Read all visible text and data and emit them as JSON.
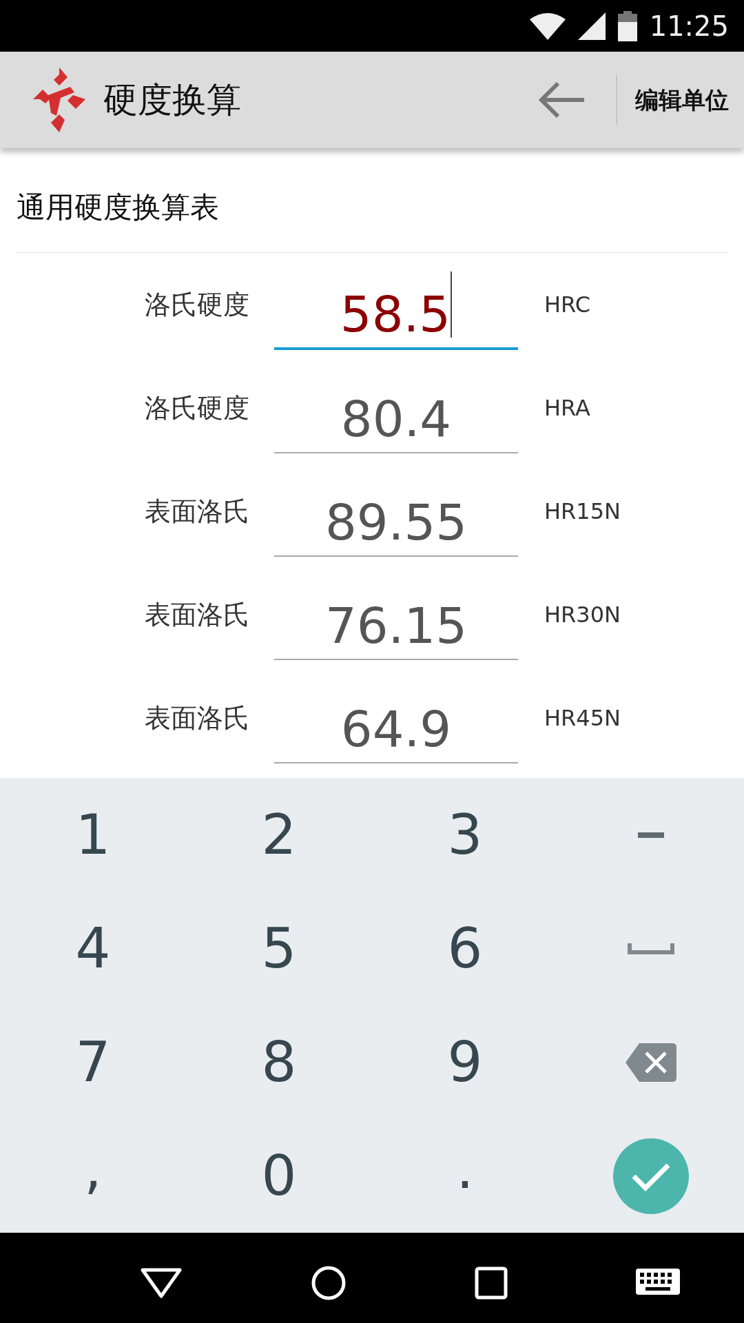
{
  "status_bar": {
    "time": "11:25"
  },
  "app_bar": {
    "title": "硬度换算",
    "action": "编辑单位"
  },
  "section_title": "通用硬度换算表",
  "rows": [
    {
      "label": "洛氏硬度",
      "value": "58.5",
      "unit": "HRC",
      "focused": true
    },
    {
      "label": "洛氏硬度",
      "value": "80.4",
      "unit": "HRA",
      "focused": false
    },
    {
      "label": "表面洛氏",
      "value": "89.55",
      "unit": "HR15N",
      "focused": false
    },
    {
      "label": "表面洛氏",
      "value": "76.15",
      "unit": "HR30N",
      "focused": false
    },
    {
      "label": "表面洛氏",
      "value": "64.9",
      "unit": "HR45N",
      "focused": false
    }
  ],
  "keyboard": [
    {
      "kind": "text",
      "label": "1"
    },
    {
      "kind": "text",
      "label": "2"
    },
    {
      "kind": "text",
      "label": "3"
    },
    {
      "kind": "minus"
    },
    {
      "kind": "text",
      "label": "4"
    },
    {
      "kind": "text",
      "label": "5"
    },
    {
      "kind": "text",
      "label": "6"
    },
    {
      "kind": "space"
    },
    {
      "kind": "text",
      "label": "7"
    },
    {
      "kind": "text",
      "label": "8"
    },
    {
      "kind": "text",
      "label": "9"
    },
    {
      "kind": "backspace"
    },
    {
      "kind": "punct",
      "label": ","
    },
    {
      "kind": "text",
      "label": "0"
    },
    {
      "kind": "punct",
      "label": "."
    },
    {
      "kind": "done"
    }
  ]
}
